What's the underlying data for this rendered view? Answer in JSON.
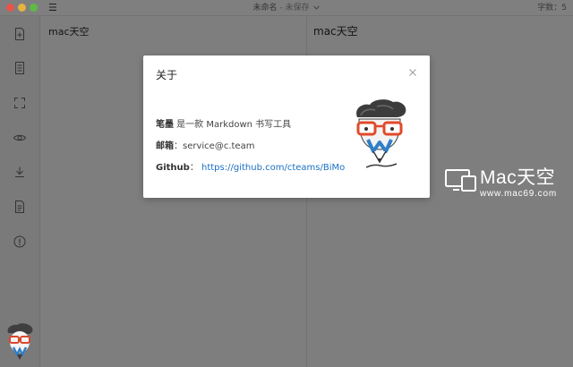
{
  "titlebar": {
    "menu_icon": "hamburger-icon",
    "doc_name": "未命名",
    "separator": " - ",
    "save_status": "未保存",
    "word_count": "字数：5"
  },
  "sidebar": {
    "icons": [
      "new-file-icon",
      "file-list-icon",
      "fullscreen-icon",
      "preview-eye-icon",
      "download-icon",
      "document-icon",
      "info-icon"
    ],
    "avatar": "mascot-avatar-icon"
  },
  "editor": {
    "content": "mac天空"
  },
  "preview": {
    "content": "mac天空"
  },
  "about_dialog": {
    "title": "关于",
    "close_icon": "close-icon",
    "app_name": "笔墨",
    "app_desc": " 是一款 Markdown 书写工具",
    "email_label": "邮箱",
    "email_value": "service@c.team",
    "github_label": "Github",
    "github_url": "https://github.com/cteams/BiMo",
    "colon": "："
  },
  "watermark": {
    "title": "Mac天空",
    "subtitle": "www.mac69.com"
  },
  "colors": {
    "link": "#1a6fc4",
    "overlay": "#7d7d7d",
    "dialog_bg": "#ffffff",
    "mascot_red": "#e04a2a",
    "mascot_blue": "#2f7fc8"
  }
}
